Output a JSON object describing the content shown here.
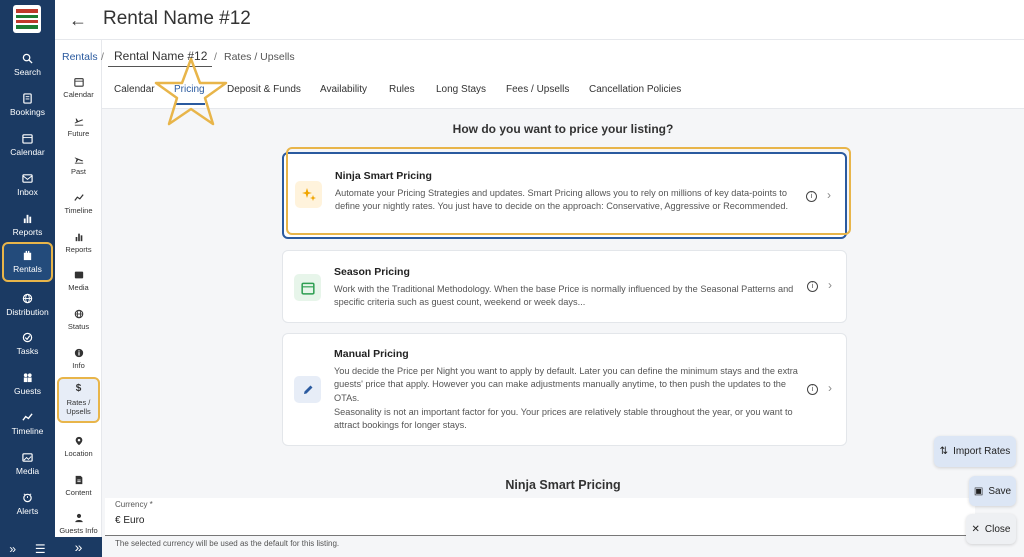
{
  "header": {
    "title": "Rental Name #12"
  },
  "breadcrumb": {
    "root": "Rentals",
    "rental": "Rental Name #12",
    "current": "Rates / Upsells"
  },
  "nav": {
    "items": [
      {
        "label": "Search",
        "icon": "search-icon"
      },
      {
        "label": "Bookings",
        "icon": "bookings-icon"
      },
      {
        "label": "Calendar",
        "icon": "calendar-icon"
      },
      {
        "label": "Inbox",
        "icon": "inbox-icon"
      },
      {
        "label": "Reports",
        "icon": "reports-icon"
      },
      {
        "label": "Rentals",
        "icon": "rentals-icon"
      },
      {
        "label": "Distribution",
        "icon": "distribution-icon"
      },
      {
        "label": "Tasks",
        "icon": "tasks-icon"
      },
      {
        "label": "Guests",
        "icon": "guests-icon"
      },
      {
        "label": "Timeline",
        "icon": "timeline-icon"
      },
      {
        "label": "Media",
        "icon": "media-icon"
      },
      {
        "label": "Alerts",
        "icon": "alerts-icon"
      }
    ]
  },
  "subnav": {
    "items": [
      {
        "label": "Calendar"
      },
      {
        "label": "Future"
      },
      {
        "label": "Past"
      },
      {
        "label": "Timeline"
      },
      {
        "label": "Reports"
      },
      {
        "label": "Media"
      },
      {
        "label": "Status"
      },
      {
        "label": "Info"
      },
      {
        "label": "Rates /\nUpsells"
      },
      {
        "label": "Location"
      },
      {
        "label": "Content"
      },
      {
        "label": "Guests Info"
      }
    ]
  },
  "tabs": [
    {
      "label": "Calendar"
    },
    {
      "label": "Pricing"
    },
    {
      "label": "Deposit & Funds"
    },
    {
      "label": "Availability"
    },
    {
      "label": "Rules"
    },
    {
      "label": "Long Stays"
    },
    {
      "label": "Fees / Upsells"
    },
    {
      "label": "Cancellation Policies"
    }
  ],
  "main": {
    "question": "How do you want to price your listing?",
    "options": [
      {
        "title": "Ninja Smart Pricing",
        "description": "Automate your Pricing Strategies and updates. Smart Pricing allows you to rely on millions of key data-points to define your nightly rates. You just have to decide on the approach: Conservative, Aggressive or Recommended.",
        "icon": "sparkles-icon"
      },
      {
        "title": "Season Pricing",
        "description": "Work with the Traditional Methodology. When the base Price is normally influenced by the Seasonal Patterns and specific criteria such as guest count, weekend or week days...",
        "icon": "calendar-icon"
      },
      {
        "title": "Manual Pricing",
        "description": "You decide the Price per Night you want to apply by default. Later you can define the minimum stays and the extra guests' price that apply. However you can make adjustments manually anytime, to then push the updates to the OTAs.",
        "description2": "Seasonality is not an important factor for you. Your prices are relatively stable throughout the year, or you want to attract bookings for longer stays.",
        "icon": "pencil-icon"
      }
    ],
    "section_title": "Ninja Smart Pricing",
    "currency": {
      "label": "Currency *",
      "value": "€ Euro",
      "help": "The selected currency will be used as the default for this listing."
    }
  },
  "actions": {
    "import": "Import Rates",
    "save": "Save",
    "close": "Close"
  },
  "colors": {
    "nav_bg": "#1b3a63",
    "accent": "#2a5a9f",
    "highlight": "#e8b54a"
  }
}
